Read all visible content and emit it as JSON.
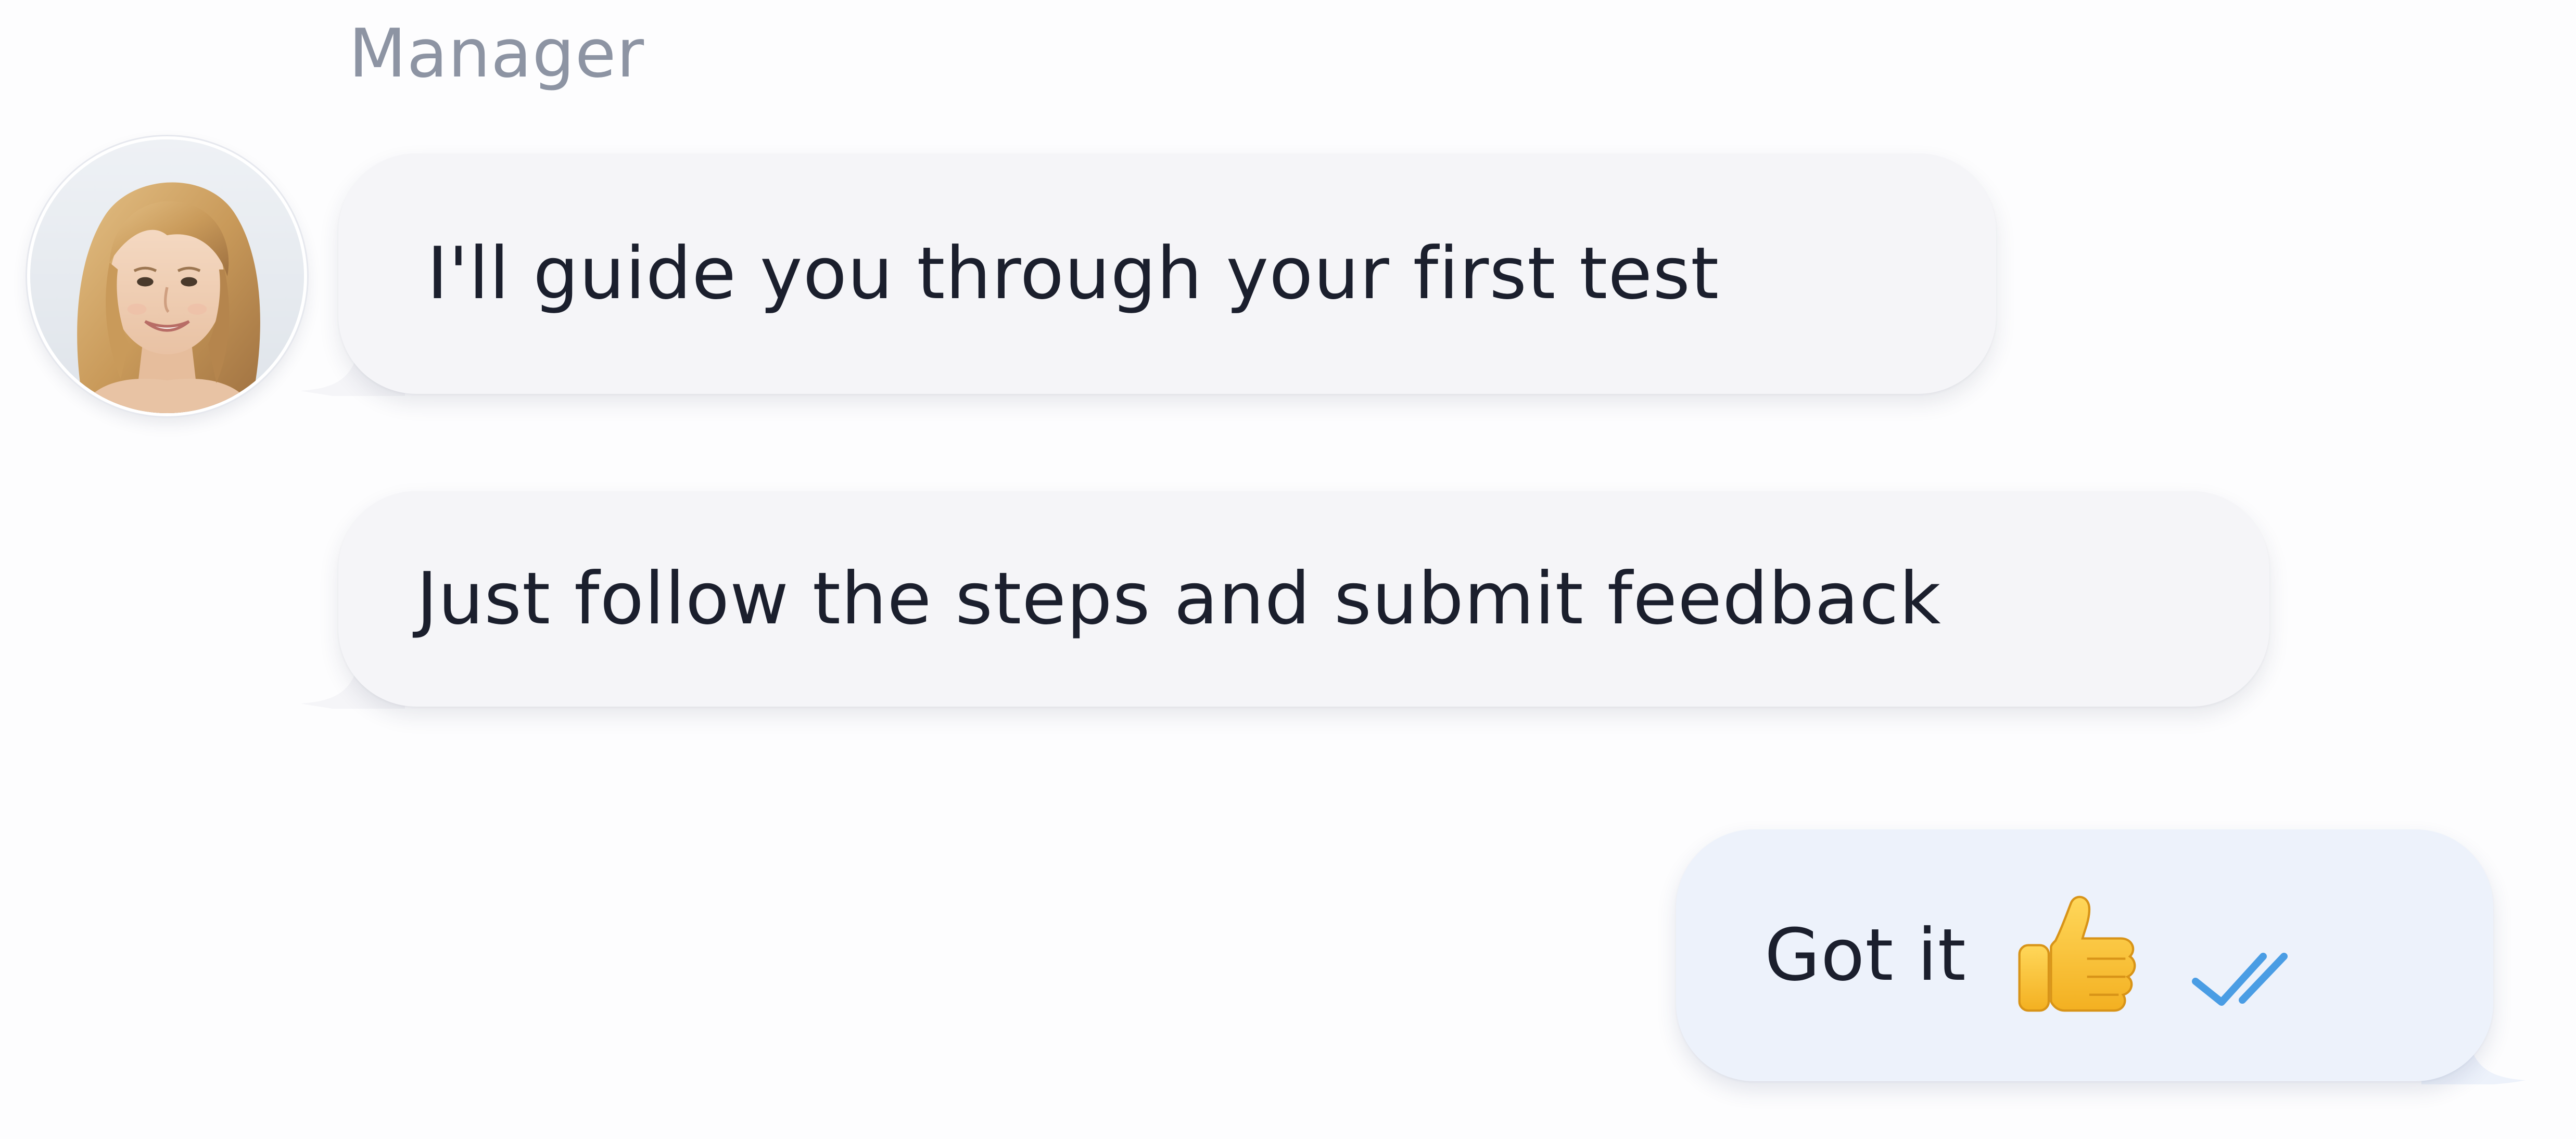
{
  "conversation": {
    "sender_name": "Manager",
    "messages": [
      {
        "direction": "incoming",
        "text": "I'll guide you through your first test"
      },
      {
        "direction": "incoming",
        "text": "Just follow the steps and submit feedback"
      },
      {
        "direction": "outgoing",
        "text": "Got it",
        "emoji": "thumbs-up-icon",
        "status": "read"
      }
    ]
  },
  "colors": {
    "background": "#fdfdfe",
    "incoming_bubble": "#f5f5f8",
    "outgoing_bubble": "#edf2fb",
    "text": "#1b1f2d",
    "sender_name": "#8d94a3",
    "read_check": "#4a9de4"
  }
}
